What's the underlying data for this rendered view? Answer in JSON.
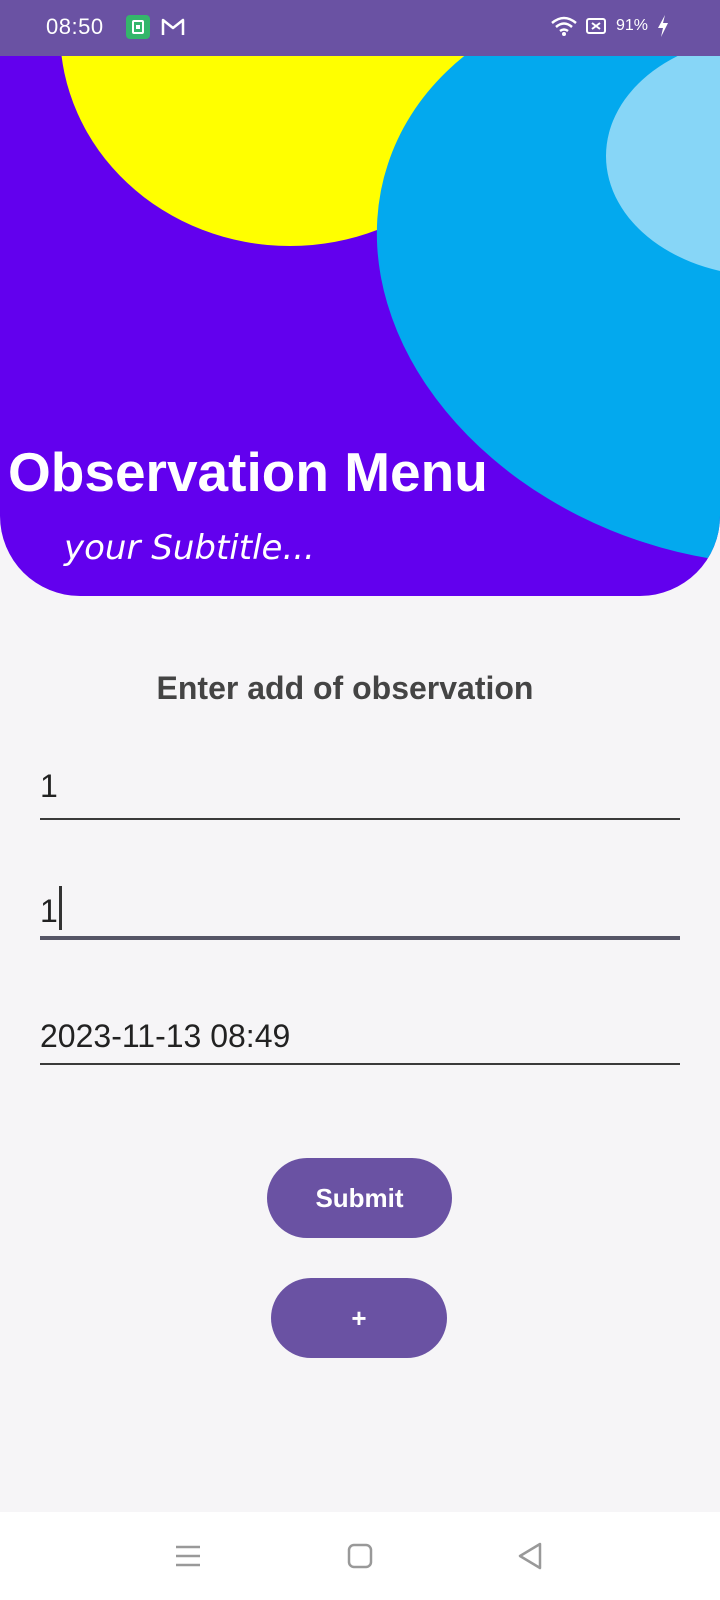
{
  "status_bar": {
    "time": "08:50",
    "battery_percent": "91%",
    "icons": [
      "app-notification-icon",
      "gmail-icon",
      "wifi-icon",
      "battery-saver-icon",
      "charging-icon"
    ]
  },
  "header": {
    "title": "Observation Menu",
    "subtitle": "your Subtitle..."
  },
  "form": {
    "heading": "Enter add of observation",
    "fields": [
      {
        "value": "1"
      },
      {
        "value": "1"
      },
      {
        "value": "2023-11-13 08:49"
      }
    ],
    "submit_label": "Submit",
    "add_label": "+"
  },
  "nav_bar": {
    "icons": [
      "menu-icon",
      "home-icon",
      "back-icon"
    ]
  },
  "colors": {
    "status_bar": "#6a52a3",
    "header_bg": "#6200ee",
    "blob_yellow": "#ffff00",
    "blob_blue": "#03a9ee",
    "blob_light_blue": "#87d6f7",
    "button_bg": "#6a52a3",
    "page_bg": "#f6f5f7"
  }
}
